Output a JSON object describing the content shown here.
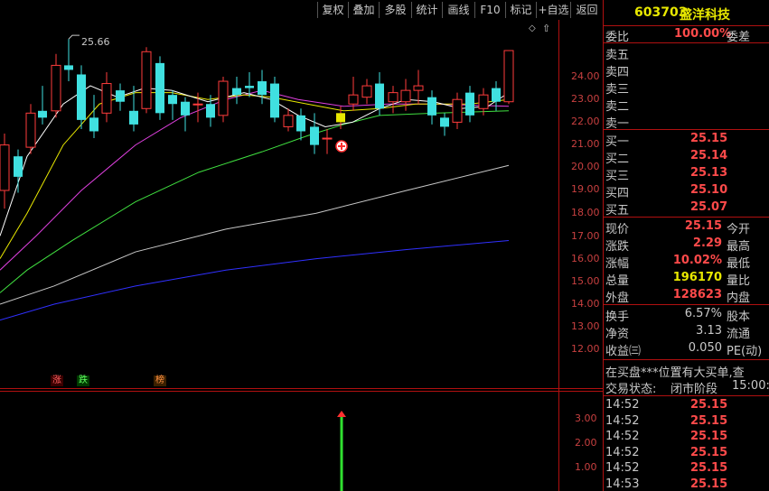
{
  "toolbar": {
    "buttons": [
      "复权",
      "叠加",
      "多股",
      "统计",
      "画线",
      "F10",
      "标记",
      "+自选",
      "返回"
    ]
  },
  "stock": {
    "code": "603703",
    "name": "盛洋科技",
    "header_color": "#e8e800"
  },
  "colors": {
    "up": "#ff3c3c",
    "down": "#40e0e0",
    "frame": "#b01010",
    "ma5": "#ffffff",
    "ma10": "#e8e800",
    "ma20": "#e040e0",
    "ma30": "#40e040",
    "ma60": "#c8c8c8",
    "ma120": "#3030ff"
  },
  "chart": {
    "y_ticks": [
      "24.00",
      "23.00",
      "22.00",
      "21.00",
      "20.00",
      "19.00",
      "18.00",
      "17.00",
      "16.00",
      "15.00",
      "14.00",
      "13.00",
      "12.00"
    ],
    "high_label": "25.66",
    "flags": [
      "涨",
      "跌",
      "榜"
    ],
    "sub_ticks": [
      "3.00",
      "2.00",
      "1.00"
    ]
  },
  "quote": {
    "weibi_label": "委比",
    "weibi_value": "100.00%",
    "weicha_label": "委差",
    "sell": [
      {
        "label": "卖五",
        "price": ""
      },
      {
        "label": "卖四",
        "price": ""
      },
      {
        "label": "卖三",
        "price": ""
      },
      {
        "label": "卖二",
        "price": ""
      },
      {
        "label": "卖一",
        "price": ""
      }
    ],
    "buy": [
      {
        "label": "买一",
        "price": "25.15"
      },
      {
        "label": "买二",
        "price": "25.14"
      },
      {
        "label": "买三",
        "price": "25.13"
      },
      {
        "label": "买四",
        "price": "25.10"
      },
      {
        "label": "买五",
        "price": "25.07"
      }
    ],
    "stats": [
      {
        "label": "现价",
        "value": "25.15",
        "label2": "今开",
        "cls": "red"
      },
      {
        "label": "涨跌",
        "value": "2.29",
        "label2": "最高",
        "cls": "red"
      },
      {
        "label": "涨幅",
        "value": "10.02%",
        "label2": "最低",
        "cls": "red"
      },
      {
        "label": "总量",
        "value": "196170",
        "label2": "量比",
        "cls": "yellow"
      },
      {
        "label": "外盘",
        "value": "128623",
        "label2": "内盘",
        "cls": "red"
      }
    ],
    "stats2": [
      {
        "label": "换手",
        "value": "6.57%",
        "label2": "股本"
      },
      {
        "label": "净资",
        "value": "3.13",
        "label2": "流通"
      },
      {
        "label": "收益㈢",
        "value": "0.050",
        "label2": "PE(动)"
      }
    ],
    "notice": "在买盘***位置有大买单,查",
    "status_label": "交易状态:",
    "status_value": "闭市阶段",
    "status_time": "15:00:",
    "ticks": [
      {
        "time": "14:52",
        "price": "25.15"
      },
      {
        "time": "14:52",
        "price": "25.15"
      },
      {
        "time": "14:52",
        "price": "25.15"
      },
      {
        "time": "14:52",
        "price": "25.15"
      },
      {
        "time": "14:52",
        "price": "25.15"
      },
      {
        "time": "14:53",
        "price": "25.15"
      }
    ]
  }
}
